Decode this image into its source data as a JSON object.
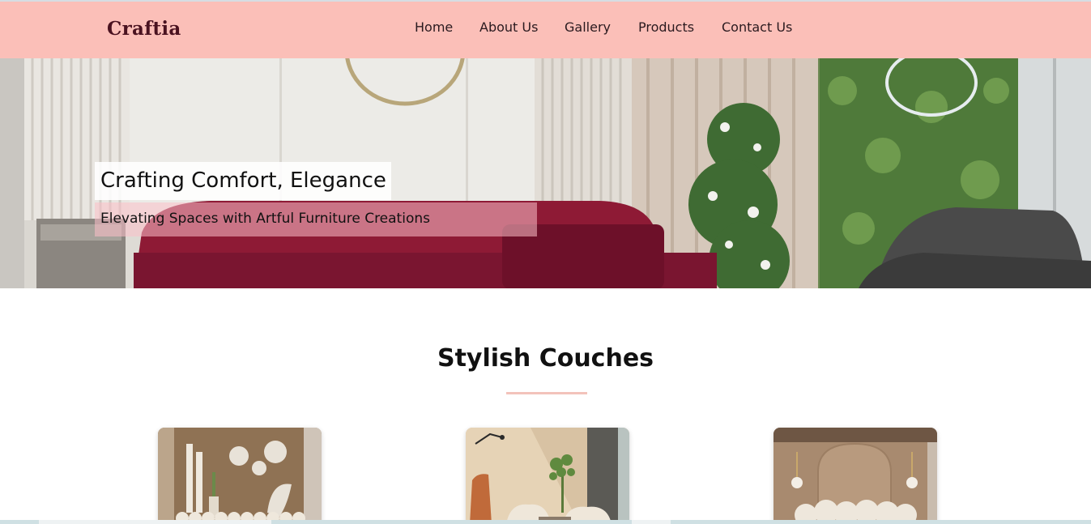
{
  "brand": {
    "name": "Craftia"
  },
  "nav": {
    "items": [
      {
        "label": "Home"
      },
      {
        "label": "About Us"
      },
      {
        "label": "Gallery"
      },
      {
        "label": "Products"
      },
      {
        "label": "Contact Us"
      }
    ]
  },
  "hero": {
    "heading": "Crafting Comfort, Elegance",
    "subheading": "Elevating Spaces with Artful Furniture Creations"
  },
  "section": {
    "title": "Stylish Couches"
  },
  "colors": {
    "navbar_bg": "#fbbfb8",
    "brand": "#4a1220",
    "accent_underline": "#f3c3bb",
    "hero_sofa": "#8e1a35"
  }
}
